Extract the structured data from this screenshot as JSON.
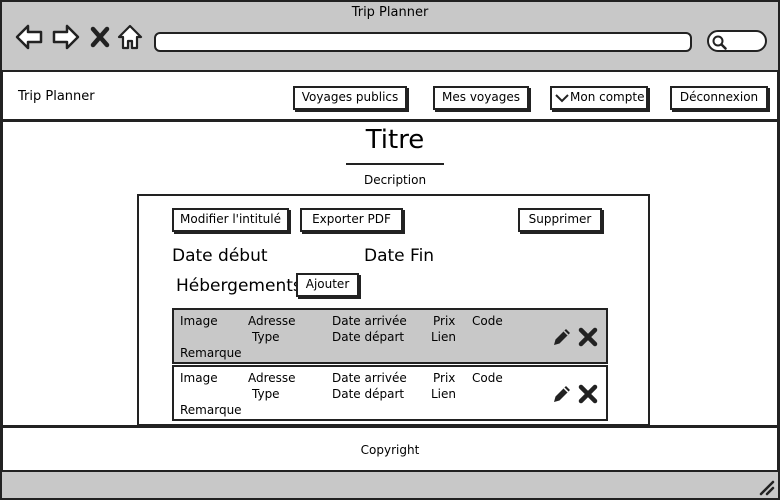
{
  "window": {
    "title": "Trip Planner"
  },
  "header": {
    "brand": "Trip Planner",
    "nav": {
      "public_trips": "Voyages publics",
      "my_trips": "Mes voyages",
      "account": "Mon compte",
      "logout": "Déconnexion"
    }
  },
  "trip": {
    "title": "Titre",
    "description": "Decription",
    "actions": {
      "rename": "Modifier l'intitulé",
      "export": "Exporter PDF",
      "delete": "Supprimer"
    },
    "date_start": "Date début",
    "date_end": "Date Fin",
    "lodging": {
      "heading": "Hébergements",
      "add": "Ajouter",
      "rows": [
        {
          "image": "Image",
          "address": "Adresse",
          "type": "Type",
          "arrival": "Date arrivée",
          "departure": "Date départ",
          "price": "Prix",
          "link": "Lien",
          "code": "Code",
          "remark": "Remarque"
        },
        {
          "image": "Image",
          "address": "Adresse",
          "type": "Type",
          "arrival": "Date arrivée",
          "departure": "Date départ",
          "price": "Prix",
          "link": "Lien",
          "code": "Code",
          "remark": "Remarque"
        }
      ]
    }
  },
  "footer": {
    "copyright": "Copyright"
  },
  "colors": {
    "chrome": "#c8c8c8",
    "row_selected": "#c8c8c8",
    "ink": "#222222"
  }
}
